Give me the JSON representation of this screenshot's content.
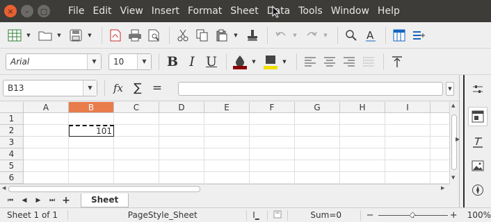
{
  "menu": {
    "window_buttons": [
      "×",
      "–",
      "▢"
    ],
    "items": [
      "File",
      "Edit",
      "View",
      "Insert",
      "Format",
      "Sheet",
      "Data",
      "Tools",
      "Window",
      "Help"
    ]
  },
  "toolbar2": {
    "font_name": "Arial",
    "font_size": "10",
    "bold": "B",
    "italic": "I",
    "underline": "U",
    "font_color": "#8b0000",
    "highlight_color": "#f0e000"
  },
  "formula_bar": {
    "name_box": "B13",
    "function_wizard": "fx",
    "sum_symbol": "∑",
    "equals_symbol": "=",
    "formula": ""
  },
  "grid": {
    "columns": [
      "A",
      "B",
      "C",
      "D",
      "E",
      "F",
      "G",
      "H",
      "I"
    ],
    "selected_column": "B",
    "rows": [
      "1",
      "2",
      "3",
      "4",
      "5",
      "6"
    ],
    "cells": [
      {
        "ref": "B2",
        "value": "101"
      }
    ]
  },
  "sheet_tabs": {
    "add_symbol": "+",
    "tabs": [
      "Sheet"
    ]
  },
  "status": {
    "sheet_info": "Sheet 1 of 1",
    "page_style": "PageStyle_Sheet",
    "sum": "Sum=0",
    "zoom": "100%",
    "minus": "−",
    "plus": "+"
  },
  "colors": {
    "menubar_bg": "#3d3c38",
    "selected_header": "#e87c4b",
    "close_button": "#e86032"
  }
}
